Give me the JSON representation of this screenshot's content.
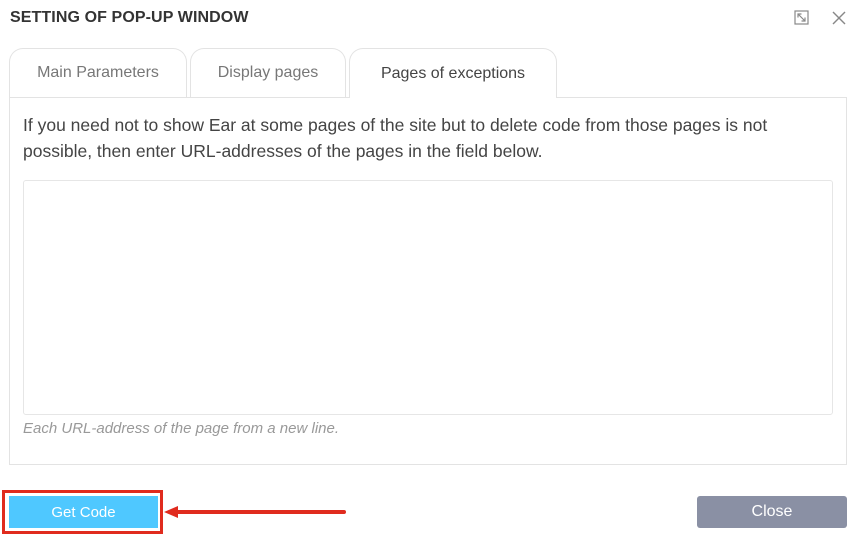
{
  "dialog": {
    "title": "SETTING OF POP-UP WINDOW",
    "maximize_icon": "maximize-icon",
    "close_icon": "close-icon"
  },
  "tabs": [
    {
      "label": "Main Parameters",
      "active": false
    },
    {
      "label": "Display pages",
      "active": false
    },
    {
      "label": "Pages of exceptions",
      "active": true
    }
  ],
  "panel": {
    "instructions": "If you need not to show Ear at some pages of the site but to delete code from those pages is not possible, then enter URL-addresses of the pages in the field below.",
    "textarea_value": "",
    "hint": "Each URL-address of the page from a new line."
  },
  "footer": {
    "get_code_label": "Get Code",
    "close_label": "Close"
  },
  "colors": {
    "get_code_button": "#4fc8ff",
    "close_button": "#8a90a4",
    "annotation_red": "#e02b1e"
  }
}
